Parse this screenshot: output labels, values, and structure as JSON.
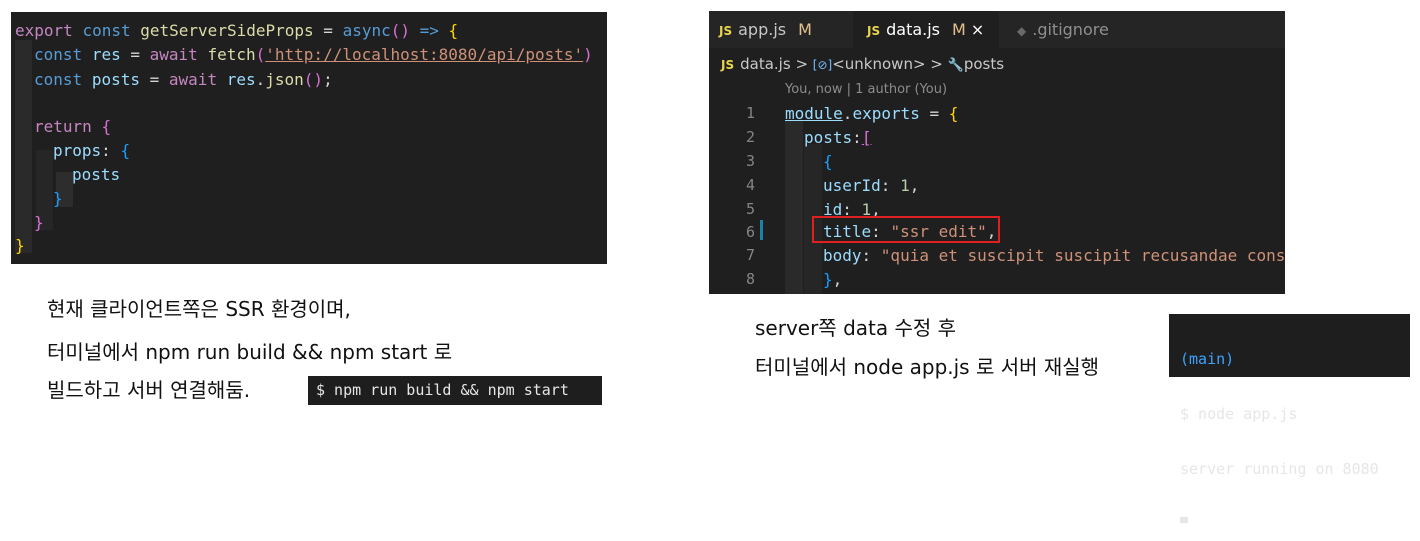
{
  "left_code": {
    "lines": [
      {
        "kw": "export",
        "kw2": "const",
        "name": "getServerSideProps",
        "eq": "=",
        "async": "async",
        "paren": "()",
        "arrow": "=>",
        "brace": "{"
      },
      {
        "kw": "const",
        "name": "res",
        "eq": "=",
        "await": "await",
        "fn": "fetch",
        "open": "(",
        "url": "'http://localhost:8080/api/posts'",
        "close": ")"
      },
      {
        "kw": "const",
        "name": "posts",
        "eq": "=",
        "await": "await",
        "obj": "res",
        "dot": ".",
        "fn": "json",
        "parens": "()",
        "semi": ";"
      },
      {},
      {
        "kw": "return",
        "brace": "{"
      },
      {
        "key": "props",
        "colon": ":",
        "brace": "{"
      },
      {
        "name": "posts"
      },
      {
        "brace": "}"
      },
      {
        "brace": "}"
      },
      {
        "brace": "}"
      }
    ]
  },
  "caption_left": {
    "line1": "현재 클라이언트쪽은 SSR 환경이며,",
    "line2": "터미널에서 npm run build && npm start 로",
    "line3": "빌드하고 서버 연결해둠."
  },
  "terminal_build": {
    "command": "$ npm run build && npm start"
  },
  "editor": {
    "tabs": [
      {
        "icon": "JS",
        "label": "app.js",
        "status": "M"
      },
      {
        "icon": "JS",
        "label": "data.js",
        "status": "M",
        "close": "×"
      },
      {
        "icon": "◆",
        "label": ".gitignore"
      }
    ],
    "breadcrumb": {
      "icon": "JS",
      "file": "data.js",
      "sep": ">",
      "symbol_icon": "[⊘]",
      "symbol": "<unknown>",
      "prop_icon": "🔧",
      "prop": "posts"
    },
    "blame": "You, now | 1 author (You)",
    "line_numbers": [
      "1",
      "2",
      "3",
      "4",
      "5",
      "6",
      "7",
      "8"
    ],
    "code": {
      "l1": {
        "kw": "module",
        "dot": ".",
        "prop": "exports",
        "eq": " = ",
        "brace": "{"
      },
      "l2": {
        "key": "posts",
        "colon": ":",
        "bracket": "["
      },
      "l3": {
        "brace": "{"
      },
      "l4": {
        "key": "userId",
        "colon": ": ",
        "num": "1",
        "comma": ","
      },
      "l5": {
        "key": "id",
        "colon": ": ",
        "num": "1",
        "comma": ","
      },
      "l6": {
        "key": "title",
        "colon": ": ",
        "str": "\"ssr edit\"",
        "comma": ","
      },
      "l7": {
        "key": "body",
        "colon": ": ",
        "str": "\"quia et suscipit suscipit recusandae cons"
      },
      "l8": {
        "brace": "}",
        "comma": ","
      }
    }
  },
  "caption_right": {
    "line1": "server쪽 data 수정 후",
    "line2": "터미널에서 node app.js 로 서버 재실행"
  },
  "terminal_node": {
    "branch": "(main)",
    "command": "$ node app.js",
    "output": "server running on 8080"
  }
}
